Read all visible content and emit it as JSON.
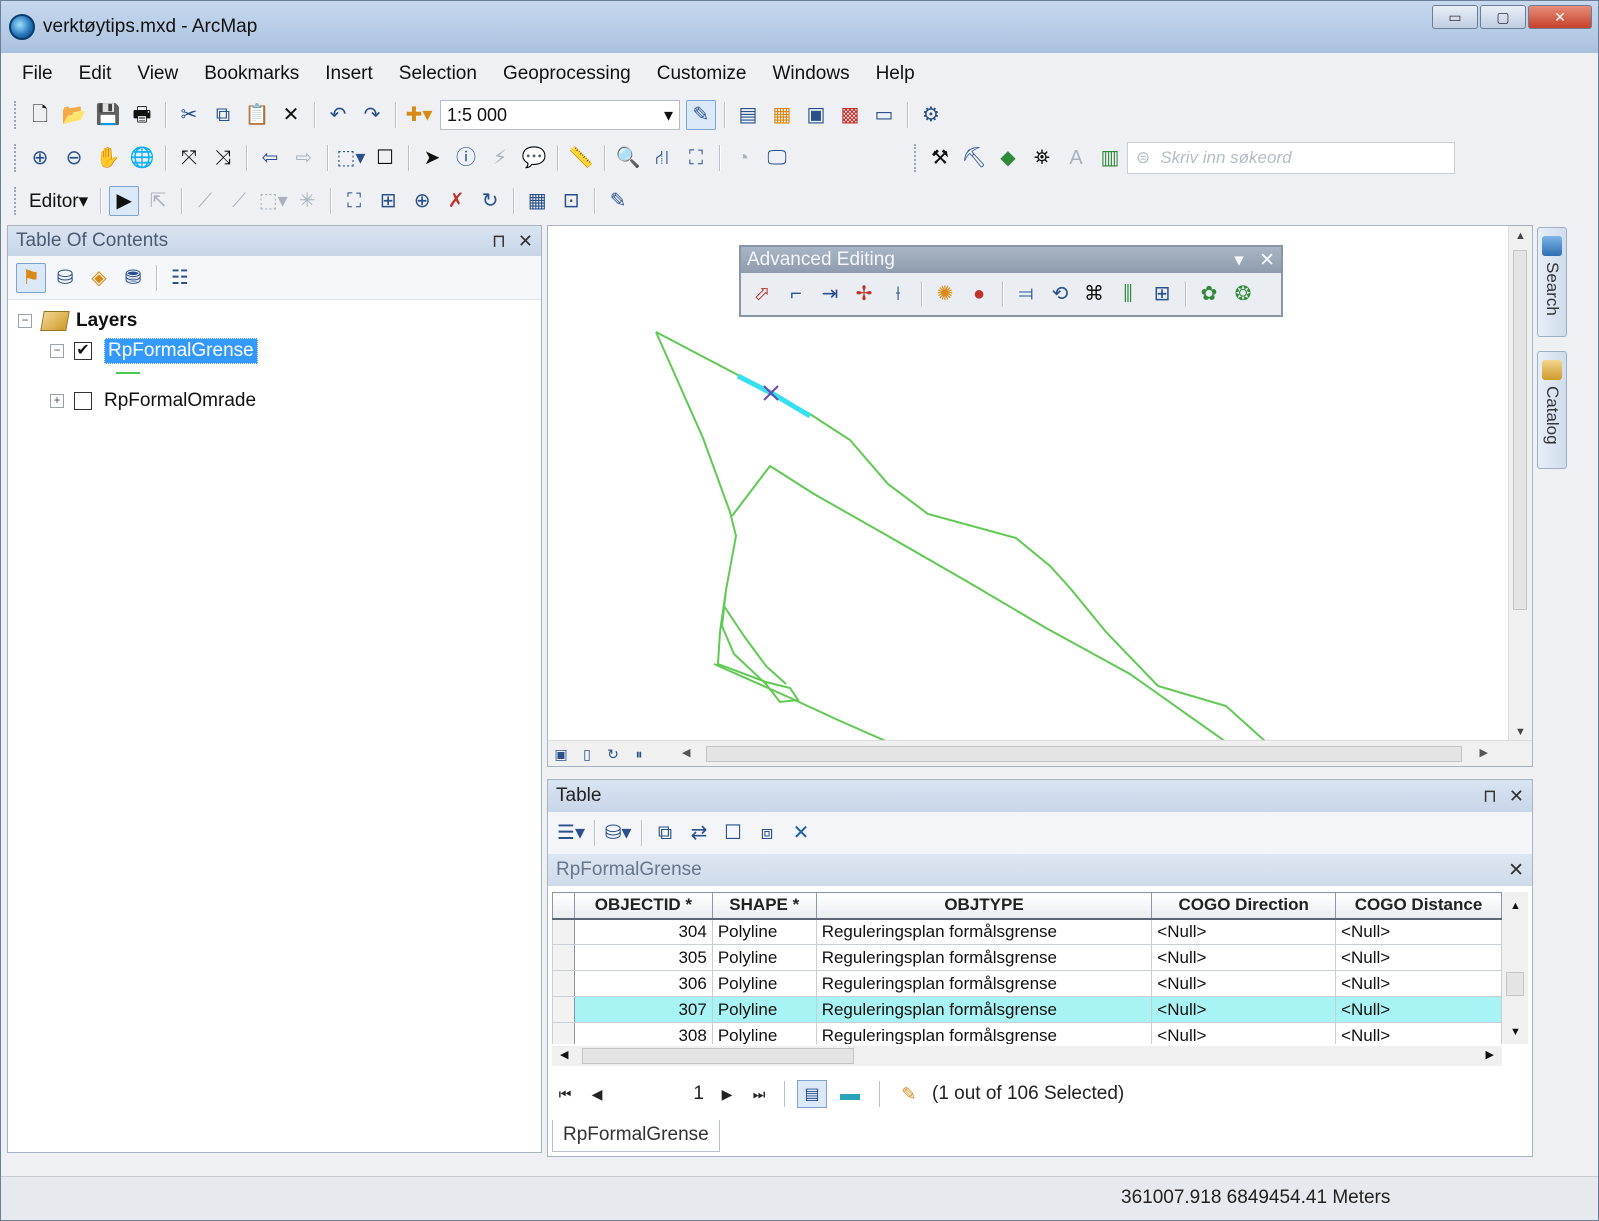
{
  "window": {
    "title": "verktøytips.mxd - ArcMap",
    "minimize": "▭",
    "maximize": "▢",
    "close": "✕"
  },
  "menu": [
    "File",
    "Edit",
    "View",
    "Bookmarks",
    "Insert",
    "Selection",
    "Geoprocessing",
    "Customize",
    "Windows",
    "Help"
  ],
  "toolbar": {
    "scale": "1:5 000",
    "scale_arrow": "▾",
    "search_placeholder": "Skriv inn søkeord",
    "editor_label": "Editor▾"
  },
  "toc": {
    "title": "Table Of Contents",
    "pin": "▾ ⊓",
    "close": "✕",
    "root_label": "Layers",
    "layers": [
      {
        "name": "RpFormalGrense",
        "checked": true,
        "selected": true,
        "expanded": true
      },
      {
        "name": "RpFormalOmrade",
        "checked": false,
        "selected": false,
        "expanded": false
      }
    ],
    "legend_color": "#4cc94c"
  },
  "advanced_editing": {
    "title": "Advanced Editing",
    "menu": "▾",
    "close": "✕"
  },
  "side_tabs": [
    "Search",
    "Catalog"
  ],
  "table": {
    "title": "Table",
    "pin": "⊓",
    "close": "✕",
    "layer_name": "RpFormalGrense",
    "layer_close": "✕",
    "columns": [
      "OBJECTID *",
      "SHAPE *",
      "OBJTYPE",
      "COGO Direction",
      "COGO Distance"
    ],
    "rows": [
      {
        "objectid": "304",
        "shape": "Polyline",
        "objtype": "Reguleringsplan formålsgrense",
        "dir": "<Null>",
        "dist": "<Null>",
        "selected": false
      },
      {
        "objectid": "305",
        "shape": "Polyline",
        "objtype": "Reguleringsplan formålsgrense",
        "dir": "<Null>",
        "dist": "<Null>",
        "selected": false
      },
      {
        "objectid": "306",
        "shape": "Polyline",
        "objtype": "Reguleringsplan formålsgrense",
        "dir": "<Null>",
        "dist": "<Null>",
        "selected": false
      },
      {
        "objectid": "307",
        "shape": "Polyline",
        "objtype": "Reguleringsplan formålsgrense",
        "dir": "<Null>",
        "dist": "<Null>",
        "selected": true
      },
      {
        "objectid": "308",
        "shape": "Polyline",
        "objtype": "Reguleringsplan formålsgrense",
        "dir": "<Null>",
        "dist": "<Null>",
        "selected": false
      }
    ],
    "current_record": "1",
    "selection_status": "(1 out of 106 Selected)",
    "tab_label": "RpFormalGrense",
    "highlight_color": "#a8f3f3"
  },
  "status": {
    "coordinates": "361007.918  6849454.41 Meters"
  },
  "colors": {
    "feature_line": "#5fca52",
    "selected_feature": "#35e0f0"
  }
}
